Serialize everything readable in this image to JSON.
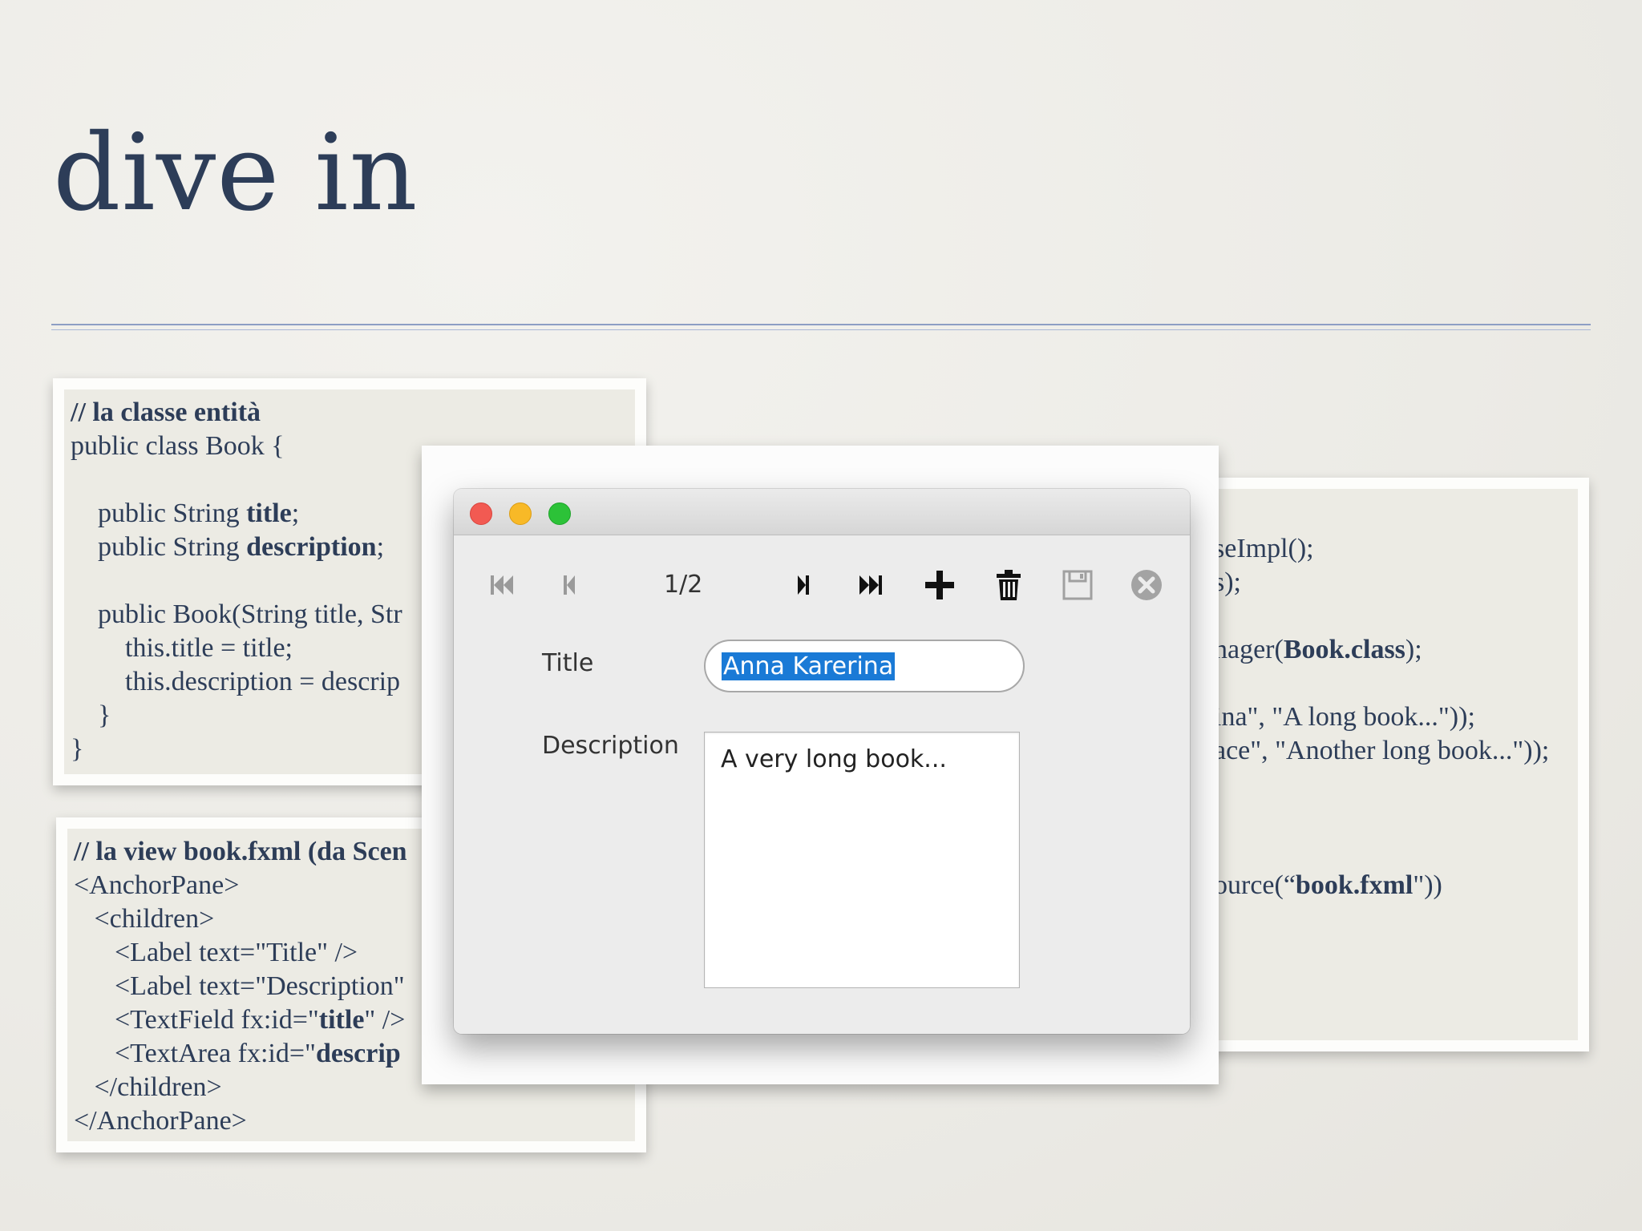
{
  "slide": {
    "title": "dive in"
  },
  "card_entity": {
    "lines": [
      [
        "// la classe entità"
      ],
      [
        "public class Book {"
      ],
      [
        ""
      ],
      [
        "    public String ",
        "title",
        ";"
      ],
      [
        "    public String ",
        "description",
        ";"
      ],
      [
        ""
      ],
      [
        "    public Book(String title, Str"
      ],
      [
        "        this.title = title;"
      ],
      [
        "        this.description = descrip"
      ],
      [
        "    }"
      ],
      [
        "}"
      ]
    ]
  },
  "card_view": {
    "lines": [
      [
        "// la view book.fxml (da Scen"
      ],
      [
        "<AnchorPane>"
      ],
      [
        "   <children>"
      ],
      [
        "      <Label text=\"Title\" />"
      ],
      [
        "      <Label text=\"Description\""
      ],
      [
        "      <TextField fx:id=\"",
        "title",
        "\" />"
      ],
      [
        "      <TextArea fx:id=\"",
        "descrip"
      ],
      [
        "   </children>"
      ],
      [
        "</AnchorPane>"
      ]
    ]
  },
  "card_main": {
    "lines": [
      [
        "seImpl();"
      ],
      [
        "s);"
      ],
      [
        ""
      ],
      [
        "nager(",
        "Book.class",
        ");"
      ],
      [
        ""
      ],
      [
        "ina\", \"A long book...\"));"
      ],
      [
        "ace\", \"Another long book...\"));"
      ],
      [
        ""
      ],
      [
        ""
      ],
      [
        ""
      ],
      [
        "ource(“",
        "book.fxml",
        "\"))"
      ]
    ]
  },
  "app_window": {
    "toolbar": {
      "first_icon": "first-record-icon",
      "prev_icon": "previous-record-icon",
      "page_indicator": "1/2",
      "next_icon": "next-record-icon",
      "last_icon": "last-record-icon",
      "add_icon": "add-icon",
      "delete_icon": "trash-icon",
      "save_icon": "save-icon",
      "close_icon": "close-circle-icon"
    },
    "form": {
      "title_label": "Title",
      "title_value": "Anna Karerina",
      "description_label": "Description",
      "description_value": "A very long book..."
    }
  },
  "colors": {
    "title_text": "#2d3d58",
    "rule": "#8d9ec4",
    "selection": "#1a7ad6",
    "traffic_close": "#f25a52",
    "traffic_min": "#f8b927",
    "traffic_max": "#2cc238"
  }
}
